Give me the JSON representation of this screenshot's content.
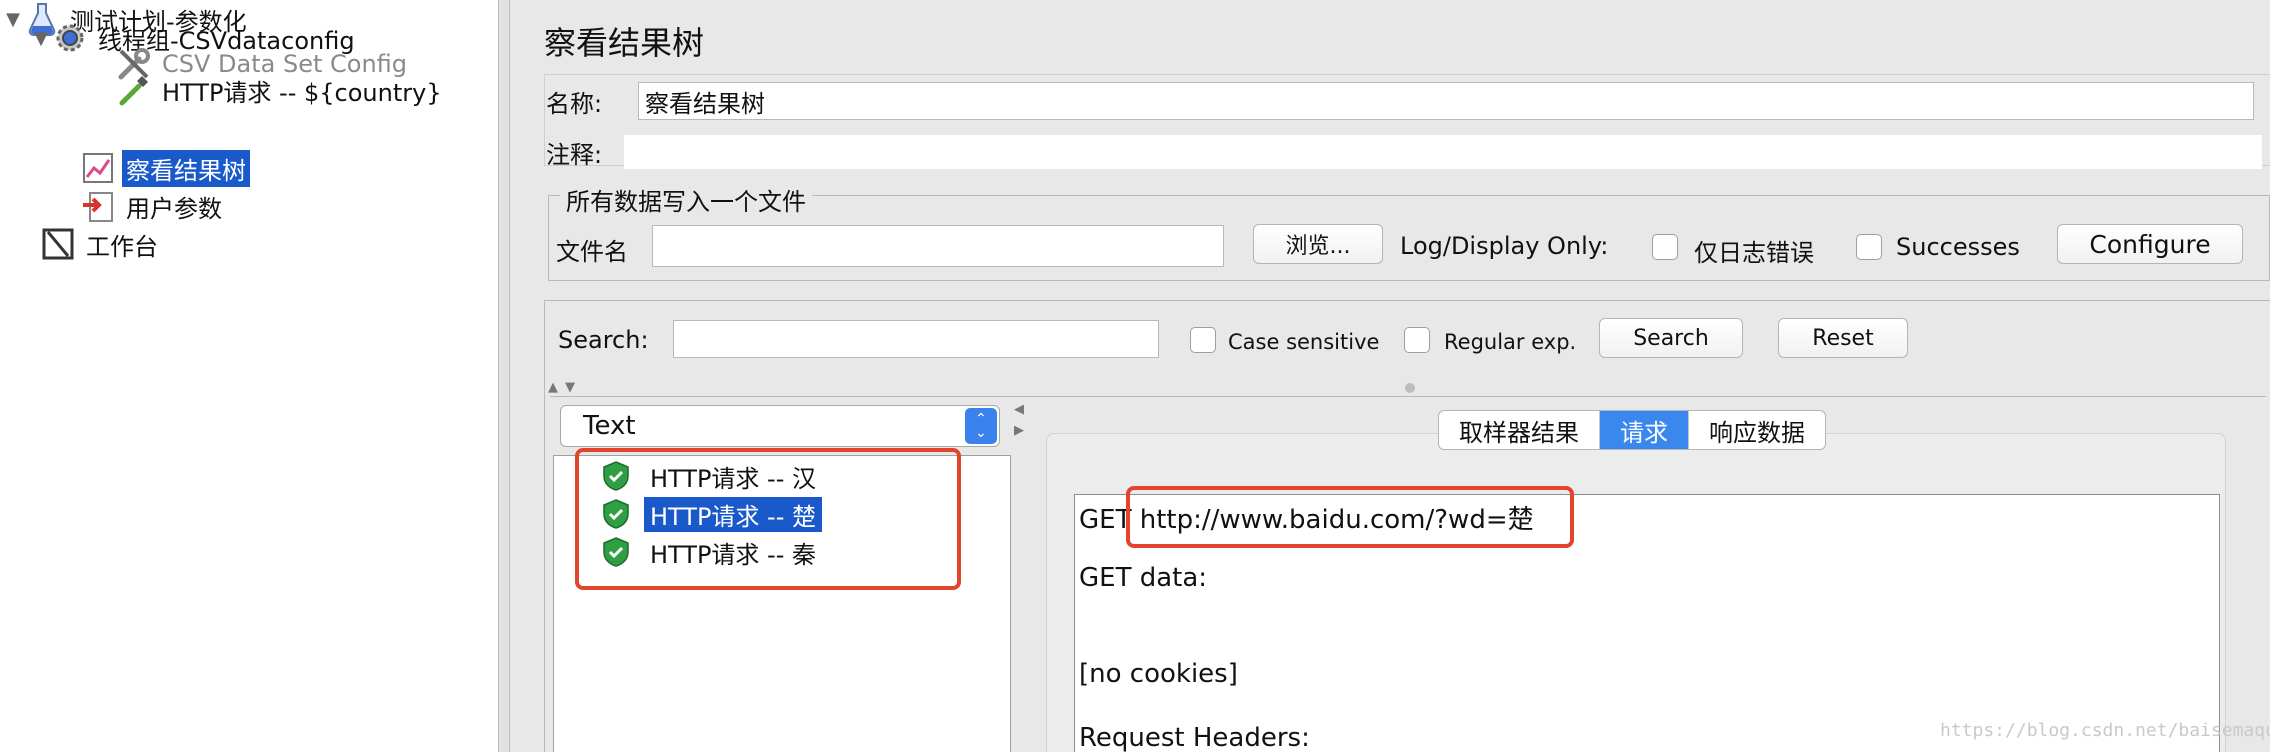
{
  "tree": {
    "items": [
      {
        "label": "测试计划-参数化",
        "toggle": "▼",
        "icon": "flask-icon"
      },
      {
        "label": "线程组-CSVdataconfig",
        "toggle": "▼",
        "icon": "gear-icon"
      },
      {
        "label": "CSV Data Set Config",
        "icon": "wrench-icon",
        "disabled": true
      },
      {
        "label": "HTTP请求 -- ${country}",
        "icon": "pipette-icon"
      },
      {
        "label": "察看结果树",
        "icon": "graph-icon",
        "selected": true
      },
      {
        "label": "用户参数",
        "icon": "user-params-icon"
      },
      {
        "label": "工作台",
        "icon": "workbench-icon"
      }
    ]
  },
  "panel": {
    "title": "察看结果树",
    "name_label": "名称:",
    "name_value": "察看结果树",
    "comment_label": "注释:",
    "comment_value": ""
  },
  "file_group": {
    "title": "所有数据写入一个文件",
    "filename_label": "文件名",
    "filename_value": "",
    "browse_label": "浏览...",
    "log_display_label": "Log/Display Only:",
    "errors_only_label": "仅日志错误",
    "successes_label": "Successes",
    "configure_label": "Configure"
  },
  "search": {
    "label": "Search:",
    "value": "",
    "case_sensitive_label": "Case sensitive",
    "regular_exp_label": "Regular exp.",
    "search_button": "Search",
    "reset_button": "Reset"
  },
  "renderer": {
    "selected": "Text"
  },
  "samples": [
    {
      "label": "HTTP请求 --  汉",
      "status": "success"
    },
    {
      "label": "HTTP请求 -- 楚",
      "status": "success",
      "selected": true
    },
    {
      "label": "HTTP请求 -- 秦",
      "status": "success"
    }
  ],
  "tabs": [
    {
      "label": "取样器结果"
    },
    {
      "label": "请求",
      "active": true
    },
    {
      "label": "响应数据"
    }
  ],
  "request": {
    "method": "GET",
    "url": "http://www.baidu.com/?wd=楚",
    "get_data_label": "GET data:",
    "cookies": "[no cookies]",
    "headers_label": "Request Headers:"
  },
  "watermark": "https://blog.csdn.net/baisemaque",
  "colors": {
    "selection": "#1a59c9",
    "active_tab": "#3a87ee",
    "highlight_box": "#e2452c",
    "success_shield": "#2ea043"
  }
}
